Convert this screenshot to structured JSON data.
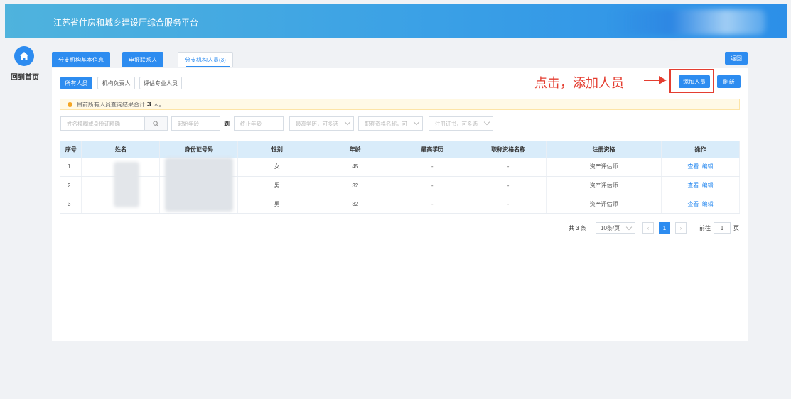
{
  "header": {
    "title": "江苏省住房和城乡建设厅综合服务平台"
  },
  "sidebar": {
    "home_label": "回到首页",
    "home_icon": "home-icon"
  },
  "tabs": [
    {
      "label": "分支机构基本信息"
    },
    {
      "label": "申报联系人"
    },
    {
      "label": "分支机构人员(3)"
    }
  ],
  "top_actions": {
    "back_label": "返回"
  },
  "sub_tabs": [
    {
      "label": "所有人员"
    },
    {
      "label": "机构负责人"
    },
    {
      "label": "评估专业人员"
    }
  ],
  "actions": {
    "add_label": "添加人员",
    "refresh_label": "刷新"
  },
  "annotation": {
    "text": "点击，添加人员"
  },
  "notice": {
    "prefix": "目前所有人员查询结果合计",
    "count": "3",
    "suffix": "人。"
  },
  "filters": {
    "search_placeholder": "姓名模糊或身份证精确",
    "age_start_placeholder": "起始年龄",
    "to_label": "到",
    "age_end_placeholder": "终止年龄",
    "education_placeholder": "最高学历，可多选",
    "title_placeholder": "职称资格名称，可",
    "cert_placeholder": "注册证书，可多选"
  },
  "table": {
    "headers": [
      "序号",
      "姓名",
      "身份证号码",
      "性别",
      "年龄",
      "最高学历",
      "职称资格名称",
      "注册资格",
      "操作"
    ],
    "rows": [
      {
        "idx": "1",
        "gender": "女",
        "age": "45",
        "edu": "-",
        "title": "-",
        "cert": "资产评估师",
        "view": "查看",
        "edit": "编辑"
      },
      {
        "idx": "2",
        "gender": "男",
        "age": "32",
        "edu": "-",
        "title": "-",
        "cert": "资产评估师",
        "view": "查看",
        "edit": "编辑"
      },
      {
        "idx": "3",
        "gender": "男",
        "age": "32",
        "edu": "-",
        "title": "-",
        "cert": "资产评估师",
        "view": "查看",
        "edit": "编辑"
      }
    ]
  },
  "pagination": {
    "total": "共 3 条",
    "page_size": "10条/页",
    "current_page": "1",
    "goto_label": "前往",
    "goto_value": "1",
    "page_suffix": "页"
  },
  "colors": {
    "primary": "#2d8cf0",
    "annotation": "#e43e31",
    "header_bg": "#3aa0e6"
  }
}
